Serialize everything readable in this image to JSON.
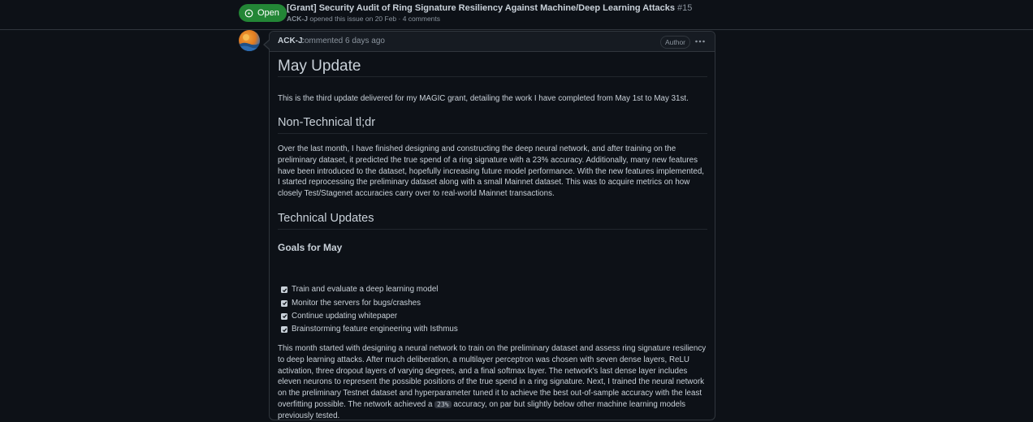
{
  "issue": {
    "state": "Open",
    "title": "[Grant] Security Audit of Ring Signature Resiliency Against Machine/Deep Learning Attacks",
    "number": "#15",
    "author": "ACK-J",
    "meta_rest": "opened this issue on 20 Feb · 4 comments"
  },
  "comment": {
    "author": "ACK-J",
    "time": "commented 6 days ago",
    "badge": "Author",
    "menu_icon": "kebab-horizontal-icon"
  },
  "content": {
    "h1": "May Update",
    "intro": "This is the third update delivered for my MAGIC grant, detailing the work I have completed from May 1st to May 31st.",
    "h2_nontech": "Non-Technical tl;dr",
    "nontech_para": "Over the last month, I have finished designing and constructing the deep neural network, and after training on the preliminary dataset, it predicted the true spend of a ring signature with a 23% accuracy. Additionally, many new features have been introduced to the dataset, hopefully increasing future model performance. With the new features implemented, I started reprocessing the preliminary dataset along with a small Mainnet dataset. This was to acquire metrics on how closely Test/Stagenet accuracies carry over to real-world Mainnet transactions.",
    "h2_tech": "Technical Updates",
    "h3_goals": "Goals for May",
    "tasks": [
      {
        "label": "Train and evaluate a deep learning model",
        "checked": true
      },
      {
        "label": "Monitor the servers for bugs/crashes",
        "checked": true
      },
      {
        "label": "Continue updating whitepaper",
        "checked": true
      },
      {
        "label": "Brainstorming feature engineering with Isthmus",
        "checked": true
      }
    ],
    "tech_para_before": "This month started with designing a neural network to train on the preliminary dataset and assess ring signature resiliency to deep learning attacks. After much deliberation, a multilayer perceptron was chosen with seven dense layers, ReLU activation, three dropout layers of varying degrees, and a final softmax layer. The network's last dense layer includes eleven neurons to represent the possible positions of the true spend in a ring signature. Next, I trained the neural network on the preliminary Testnet dataset and hyperparameter tuned it to achieve the best out-of-sample accuracy with the least overfitting possible. The network achieved a",
    "tech_para_code": "23%",
    "tech_para_after": "accuracy, on par but slightly below other machine learning models previously tested."
  },
  "colors": {
    "background": "#0d1117",
    "open_badge": "#238636",
    "border": "#30363d",
    "header_bg": "#161b22",
    "text": "#c9d1d9",
    "muted": "#8b949e"
  }
}
